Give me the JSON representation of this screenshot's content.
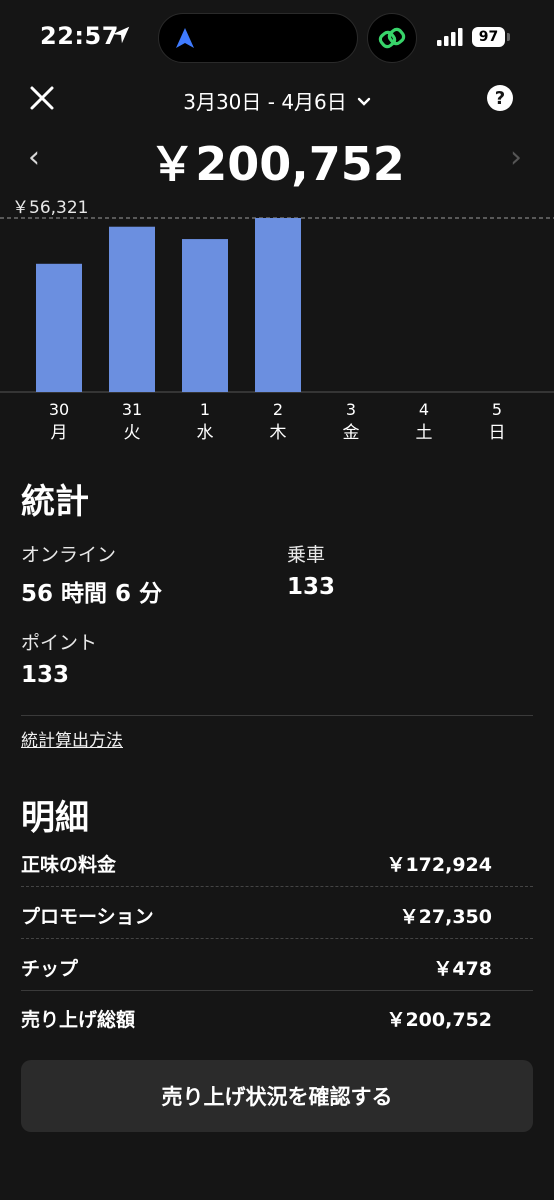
{
  "status_bar": {
    "time": "22:57",
    "battery": "97"
  },
  "header": {
    "date_range": "3月30日 - 4月6日",
    "total": "￥200,752",
    "prev": "‹",
    "next": "›",
    "help": "?"
  },
  "chart_data": {
    "type": "bar",
    "max_label": "￥56,321",
    "categories": [
      {
        "day": "30",
        "weekday": "月"
      },
      {
        "day": "31",
        "weekday": "火"
      },
      {
        "day": "1",
        "weekday": "水"
      },
      {
        "day": "2",
        "weekday": "木"
      },
      {
        "day": "3",
        "weekday": "金"
      },
      {
        "day": "4",
        "weekday": "土"
      },
      {
        "day": "5",
        "weekday": "日"
      }
    ],
    "values": [
      41500,
      53500,
      49500,
      56321,
      0,
      0,
      0
    ],
    "ylim": [
      0,
      56321
    ],
    "bar_color": "#6b8fe0"
  },
  "stats": {
    "title": "統計",
    "online_label": "オンライン",
    "online_value": "56 時間 6 分",
    "rides_label": "乗車",
    "rides_value": "133",
    "points_label": "ポイント",
    "points_value": "133",
    "method_link": "統計算出方法"
  },
  "breakdown": {
    "title": "明細",
    "items": [
      {
        "label": "正味の料金",
        "value": "￥172,924"
      },
      {
        "label": "プロモーション",
        "value": "￥27,350"
      },
      {
        "label": "チップ",
        "value": "￥478"
      },
      {
        "label": "売り上げ総額",
        "value": "￥200,752"
      }
    ]
  },
  "cta": {
    "label": "売り上げ状況を確認する"
  }
}
